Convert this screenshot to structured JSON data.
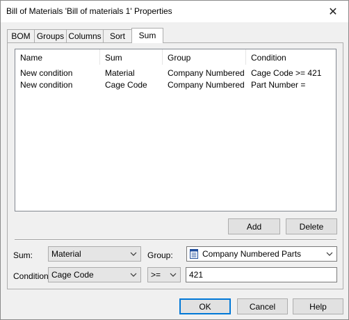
{
  "window": {
    "title": "Bill of Materials 'Bill of materials 1' Properties",
    "close_glyph": "✕"
  },
  "tabs": [
    {
      "label": "BOM",
      "active": false
    },
    {
      "label": "Groups",
      "active": false
    },
    {
      "label": "Columns",
      "active": false
    },
    {
      "label": "Sort",
      "active": false
    },
    {
      "label": "Sum",
      "active": true
    }
  ],
  "list": {
    "columns": [
      "Name",
      "Sum",
      "Group",
      "Condition"
    ],
    "rows": [
      {
        "name": "New condition",
        "sum": "Material",
        "group": "Company Numbered ...",
        "condition": "Cage Code >= 421"
      },
      {
        "name": "New condition",
        "sum": "Cage Code",
        "group": "Company Numbered ...",
        "condition": "Part Number ="
      }
    ]
  },
  "buttons": {
    "add": "Add",
    "delete": "Delete",
    "ok": "OK",
    "cancel": "Cancel",
    "help": "Help"
  },
  "form": {
    "sum_label": "Sum:",
    "sum_value": "Material",
    "group_label": "Group:",
    "group_value": "Company Numbered Parts",
    "condition_label": "Condition:",
    "condition_field": "Cage Code",
    "operator": ">=",
    "condition_value": "421"
  },
  "icons": {
    "dropdown": "chevron-down-icon",
    "group_item": "document-icon",
    "close": "close-icon"
  }
}
